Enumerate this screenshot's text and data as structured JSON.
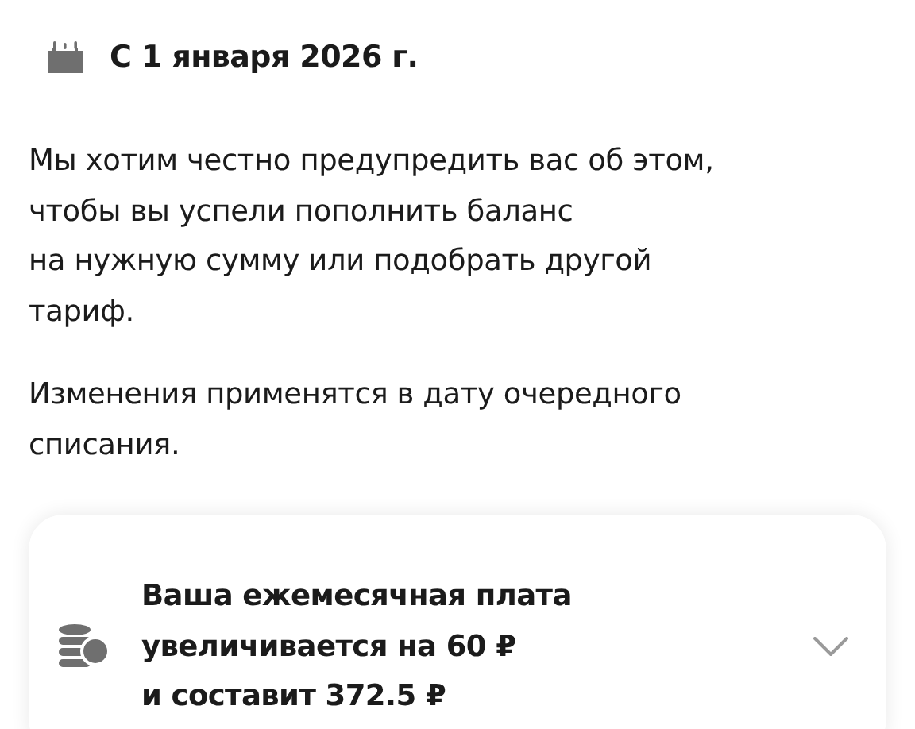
{
  "header": {
    "date": "С 1 января 2026 г."
  },
  "paragraphs": [
    [
      "Мы хотим честно предупредить вас об этом,",
      "чтобы вы успели пополнить баланс",
      "на нужную сумму или подобрать другой",
      "тариф."
    ],
    [
      "Изменения применятся в дату очередного",
      "списания."
    ]
  ],
  "card": {
    "lines": [
      "Ваша ежемесячная плата",
      "увеличивается на 60 ₽",
      "и составит 372.5 ₽"
    ],
    "expanded": false
  }
}
